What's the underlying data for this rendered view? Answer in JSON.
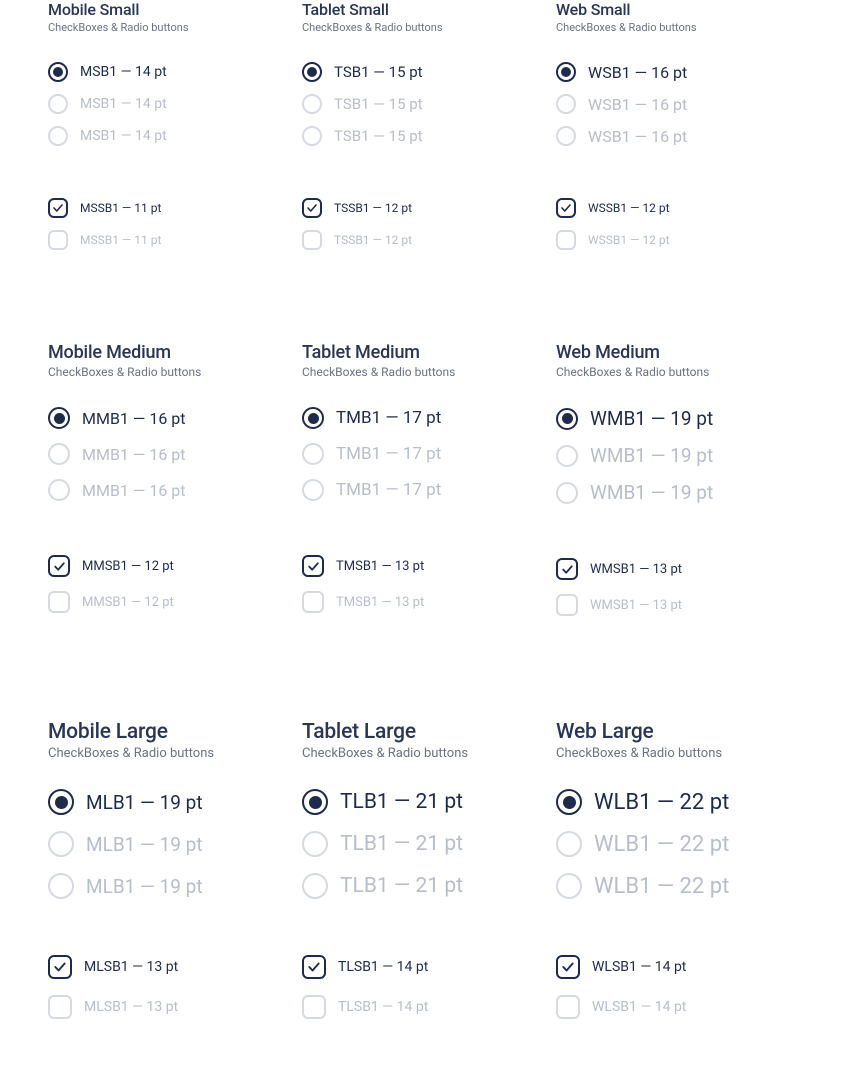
{
  "sections": [
    {
      "row": "small",
      "col": 0,
      "title": "Mobile Small",
      "sub": "CheckBoxes & Radio buttons",
      "radios": [
        {
          "label": "MSB1 — 14 pt",
          "state": "selected"
        },
        {
          "label": "MSB1 — 14 pt",
          "state": "unselected"
        },
        {
          "label": "MSB1 — 14 pt",
          "state": "unselected"
        }
      ],
      "checks": [
        {
          "label": "MSSB1 — 11 pt",
          "state": "checked"
        },
        {
          "label": "MSSB1 — 11 pt",
          "state": "unchecked"
        }
      ]
    },
    {
      "row": "small",
      "col": 1,
      "title": "Tablet Small",
      "sub": "CheckBoxes & Radio buttons",
      "radios": [
        {
          "label": "TSB1 — 15 pt",
          "state": "selected"
        },
        {
          "label": "TSB1 — 15 pt",
          "state": "unselected"
        },
        {
          "label": "TSB1 — 15 pt",
          "state": "unselected"
        }
      ],
      "checks": [
        {
          "label": "TSSB1 — 12 pt",
          "state": "checked"
        },
        {
          "label": "TSSB1 — 12 pt",
          "state": "unchecked"
        }
      ]
    },
    {
      "row": "small",
      "col": 2,
      "title": "Web Small",
      "sub": "CheckBoxes & Radio buttons",
      "radios": [
        {
          "label": "WSB1 — 16 pt",
          "state": "selected"
        },
        {
          "label": "WSB1 — 16 pt",
          "state": "unselected"
        },
        {
          "label": "WSB1 — 16 pt",
          "state": "unselected"
        }
      ],
      "checks": [
        {
          "label": "WSSB1 — 12 pt",
          "state": "checked"
        },
        {
          "label": "WSSB1 — 12 pt",
          "state": "unchecked"
        }
      ]
    },
    {
      "row": "medium",
      "col": 0,
      "title": "Mobile Medium",
      "sub": "CheckBoxes & Radio buttons",
      "radios": [
        {
          "label": "MMB1 — 16 pt",
          "state": "selected"
        },
        {
          "label": "MMB1 — 16 pt",
          "state": "unselected"
        },
        {
          "label": "MMB1 — 16 pt",
          "state": "unselected"
        }
      ],
      "checks": [
        {
          "label": "MMSB1 — 12 pt",
          "state": "checked"
        },
        {
          "label": "MMSB1 — 12 pt",
          "state": "unchecked"
        }
      ]
    },
    {
      "row": "medium",
      "col": 1,
      "title": "Tablet Medium",
      "sub": "CheckBoxes & Radio buttons",
      "radios": [
        {
          "label": "TMB1 — 17 pt",
          "state": "selected"
        },
        {
          "label": "TMB1 — 17 pt",
          "state": "unselected"
        },
        {
          "label": "TMB1 — 17 pt",
          "state": "unselected"
        }
      ],
      "checks": [
        {
          "label": "TMSB1 — 13 pt",
          "state": "checked"
        },
        {
          "label": "TMSB1 — 13 pt",
          "state": "unchecked"
        }
      ]
    },
    {
      "row": "medium",
      "col": 2,
      "title": "Web Medium",
      "sub": "CheckBoxes & Radio buttons",
      "radios": [
        {
          "label": "WMB1 — 19 pt",
          "state": "selected"
        },
        {
          "label": "WMB1 — 19 pt",
          "state": "unselected"
        },
        {
          "label": "WMB1 — 19 pt",
          "state": "unselected"
        }
      ],
      "checks": [
        {
          "label": "WMSB1 — 13 pt",
          "state": "checked"
        },
        {
          "label": "WMSB1 — 13 pt",
          "state": "unchecked"
        }
      ]
    },
    {
      "row": "large",
      "col": 0,
      "title": "Mobile Large",
      "sub": "CheckBoxes & Radio buttons",
      "radios": [
        {
          "label": "MLB1 — 19 pt",
          "state": "selected"
        },
        {
          "label": "MLB1 — 19 pt",
          "state": "unselected"
        },
        {
          "label": "MLB1 — 19 pt",
          "state": "unselected"
        }
      ],
      "checks": [
        {
          "label": "MLSB1 — 13 pt",
          "state": "checked"
        },
        {
          "label": "MLSB1 — 13 pt",
          "state": "unchecked"
        }
      ]
    },
    {
      "row": "large",
      "col": 1,
      "title": "Tablet Large",
      "sub": "CheckBoxes & Radio buttons",
      "radios": [
        {
          "label": "TLB1 — 21 pt",
          "state": "selected"
        },
        {
          "label": "TLB1 — 21 pt",
          "state": "unselected"
        },
        {
          "label": "TLB1 — 21 pt",
          "state": "unselected"
        }
      ],
      "checks": [
        {
          "label": "TLSB1 — 14 pt",
          "state": "checked"
        },
        {
          "label": "TLSB1 — 14 pt",
          "state": "unchecked"
        }
      ]
    },
    {
      "row": "large",
      "col": 2,
      "title": "Web Large",
      "sub": "CheckBoxes & Radio buttons",
      "radios": [
        {
          "label": "WLB1 — 22 pt",
          "state": "selected"
        },
        {
          "label": "WLB1 — 22 pt",
          "state": "unselected"
        },
        {
          "label": "WLB1 — 22 pt",
          "state": "unselected"
        }
      ],
      "checks": [
        {
          "label": "WLSB1 — 14 pt",
          "state": "checked"
        },
        {
          "label": "WLSB1 — 14 pt",
          "state": "unchecked"
        }
      ]
    }
  ]
}
